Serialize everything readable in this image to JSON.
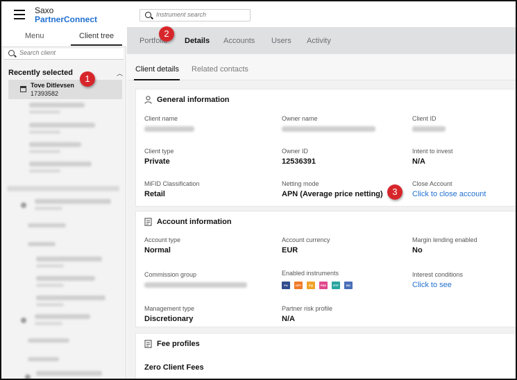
{
  "brand": {
    "line1": "Saxo",
    "line2": "PartnerConnect"
  },
  "sidebar": {
    "tabs": {
      "menu": "Menu",
      "client_tree": "Client tree"
    },
    "search_placeholder": "Search client",
    "recent_title": "Recently selected",
    "recent_item": {
      "name": "Tove Ditlevsen",
      "id": "17393582"
    }
  },
  "topbar": {
    "search_placeholder": "Instrument search"
  },
  "main_tabs": [
    "Portfolio",
    "Details",
    "Accounts",
    "Users",
    "Activity"
  ],
  "active_main_tab": "Details",
  "sub_tabs": [
    "Client details",
    "Related contacts"
  ],
  "general": {
    "title": "General information",
    "client_name_label": "Client name",
    "owner_name_label": "Owner name",
    "client_id_label": "Client ID",
    "client_type_label": "Client type",
    "client_type": "Private",
    "owner_id_label": "Owner ID",
    "owner_id": "12536391",
    "intent_label": "Intent to invest",
    "intent": "N/A",
    "mifid_label": "MiFID Classification",
    "mifid": "Retail",
    "netting_label": "Netting mode",
    "netting": "APN (Average price netting)",
    "close_label": "Close Account",
    "close_link": "Click to close account"
  },
  "account": {
    "title": "Account information",
    "type_label": "Account type",
    "type": "Normal",
    "currency_label": "Account currency",
    "currency": "EUR",
    "margin_label": "Margin lending enabled",
    "margin": "No",
    "commission_label": "Commission group",
    "enabled_label": "Enabled instruments",
    "instruments": [
      {
        "code": "FU",
        "color": "#2f4d8c"
      },
      {
        "code": "OPT",
        "color": "#f07a2a"
      },
      {
        "code": "EQ",
        "color": "#f0a32a"
      },
      {
        "code": "FND",
        "color": "#e0488d"
      },
      {
        "code": "ETF",
        "color": "#28a5a0"
      },
      {
        "code": "BO",
        "color": "#4a6fb8"
      }
    ],
    "interest_label": "Interest conditions",
    "interest_link": "Click to see",
    "mgmt_label": "Management type",
    "mgmt": "Discretionary",
    "risk_label": "Partner risk profile",
    "risk": "N/A"
  },
  "fees": {
    "title": "Fee profiles",
    "value": "Zero Client Fees"
  },
  "callouts": [
    "1",
    "2",
    "3"
  ],
  "colors": {
    "accent": "#1f6fd1",
    "callout": "#d7262b"
  }
}
